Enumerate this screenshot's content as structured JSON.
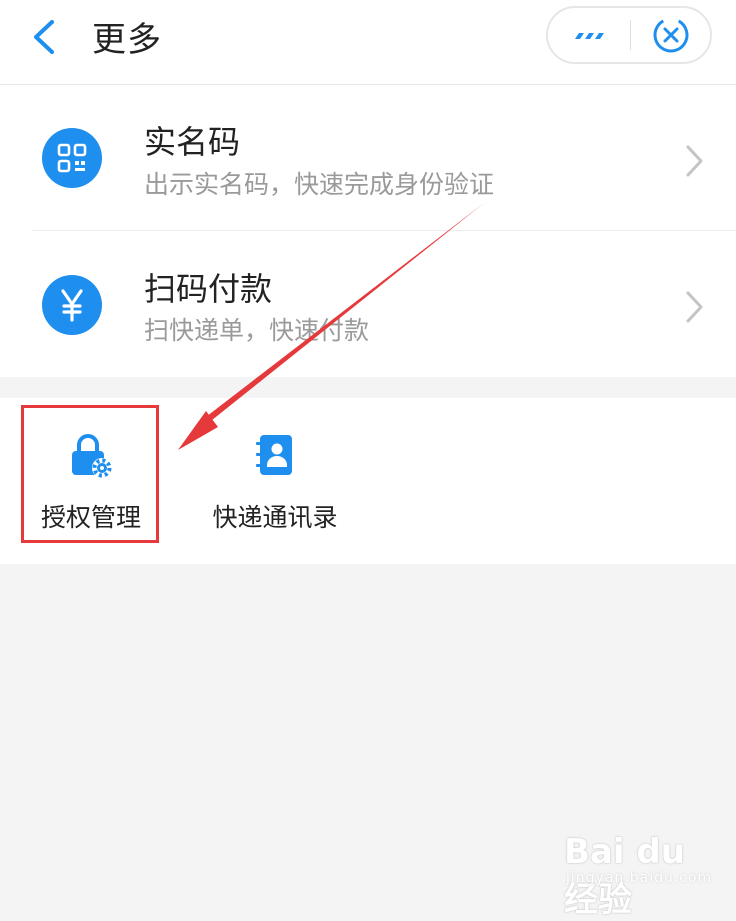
{
  "header": {
    "title": "更多"
  },
  "list": {
    "items": [
      {
        "title": "实名码",
        "subtitle": "出示实名码，快速完成身份验证",
        "icon": "qr-code-icon"
      },
      {
        "title": "扫码付款",
        "subtitle": "扫快递单，快速付款",
        "icon": "yuan-icon"
      }
    ]
  },
  "grid": {
    "items": [
      {
        "label": "授权管理",
        "icon": "lock-gear-icon"
      },
      {
        "label": "快递通讯录",
        "icon": "contacts-book-icon"
      }
    ]
  },
  "watermark": {
    "logo": "Bai du 经验",
    "url": "jingyan.baidu.com"
  },
  "colors": {
    "accent": "#1e8fee",
    "highlight": "#e5393b",
    "title_text": "#222222",
    "subtitle_text": "#9a9a9a",
    "background": "#f4f4f4"
  }
}
